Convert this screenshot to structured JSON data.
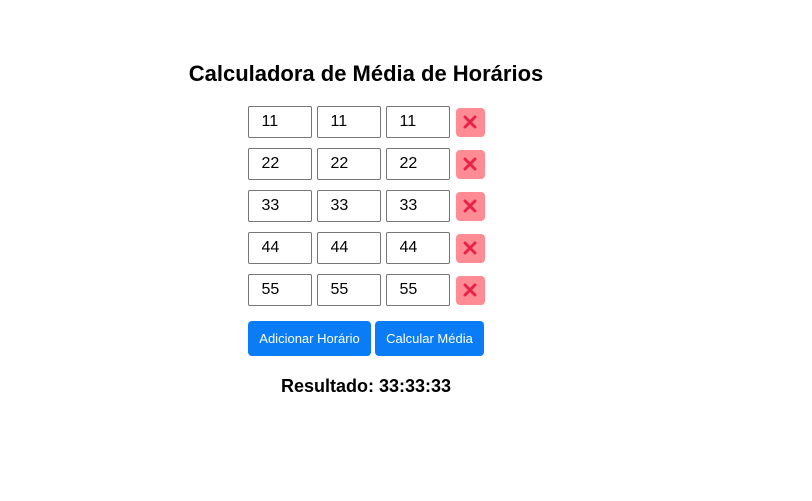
{
  "page": {
    "title": "Calculadora de Média de Horários"
  },
  "rows": [
    {
      "hours": "11",
      "minutes": "11",
      "seconds": "11"
    },
    {
      "hours": "22",
      "minutes": "22",
      "seconds": "22"
    },
    {
      "hours": "33",
      "minutes": "33",
      "seconds": "33"
    },
    {
      "hours": "44",
      "minutes": "44",
      "seconds": "44"
    },
    {
      "hours": "55",
      "minutes": "55",
      "seconds": "55"
    }
  ],
  "icons": {
    "remove": "close-icon"
  },
  "colors": {
    "remove_bg": "#ff8c95",
    "remove_icon": "#e8224a",
    "button_bg": "#0a7cf6",
    "button_text": "#ffffff"
  },
  "actions": {
    "add_label": "Adicionar Horário",
    "calc_label": "Calcular Média"
  },
  "result": {
    "label": "Resultado: 33:33:33"
  }
}
